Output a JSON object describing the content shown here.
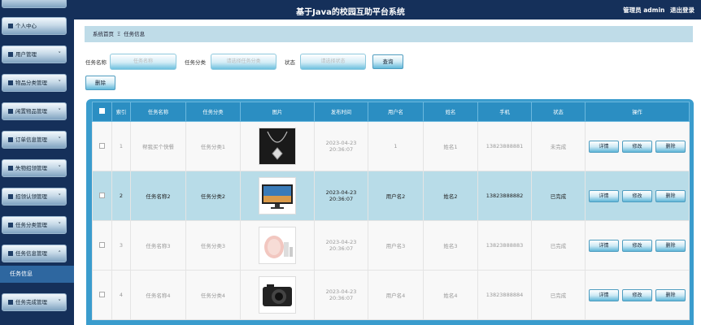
{
  "header": {
    "title": "基于Java的校园互助平台系统",
    "user_label": "管理员 admin",
    "logout": "退出登录"
  },
  "sidebar": {
    "items": [
      {
        "label": "个人中心"
      },
      {
        "label": "用户管理"
      },
      {
        "label": "物品分类管理"
      },
      {
        "label": "闲置物品管理"
      },
      {
        "label": "订单信息管理"
      },
      {
        "label": "失物招领管理"
      },
      {
        "label": "招领认领管理"
      },
      {
        "label": "任务分类管理"
      },
      {
        "label": "任务信息管理"
      },
      {
        "label": "任务完成管理"
      }
    ],
    "active_sub": "任务信息"
  },
  "breadcrumb": {
    "home": "系统首页",
    "sep": "Ξ",
    "current": "任务信息"
  },
  "search": {
    "name_label": "任务名称",
    "name_placeholder": "任务名称",
    "category_label": "任务分类",
    "category_placeholder": "请选择任务分类",
    "status_label": "状态",
    "status_placeholder": "请选择状态",
    "query_button": "查询"
  },
  "toolbar": {
    "delete_button": "删除"
  },
  "table": {
    "headers": [
      "索引",
      "任务名称",
      "任务分类",
      "图片",
      "发布时间",
      "用户名",
      "姓名",
      "手机",
      "状态",
      "操作"
    ],
    "rows": [
      {
        "index": "1",
        "name": "帮我买个快餐",
        "category": "任务分类1",
        "image": "necklace",
        "time": "2023-04-23 20:36:07",
        "username": "1",
        "realname": "姓名1",
        "phone": "13823888881",
        "status": "未完成"
      },
      {
        "index": "2",
        "name": "任务名称2",
        "category": "任务分类2",
        "image": "monitor",
        "time": "2023-04-23 20:36:07",
        "username": "用户名2",
        "realname": "姓名2",
        "phone": "13823888882",
        "status": "已完成"
      },
      {
        "index": "3",
        "name": "任务名称3",
        "category": "任务分类3",
        "image": "cosmetics",
        "time": "2023-04-23 20:36:07",
        "username": "用户名3",
        "realname": "姓名3",
        "phone": "13823888883",
        "status": "已完成"
      },
      {
        "index": "4",
        "name": "任务名称4",
        "category": "任务分类4",
        "image": "camera",
        "time": "2023-04-23 20:36:07",
        "username": "用户名4",
        "realname": "姓名4",
        "phone": "13823888884",
        "status": "已完成"
      }
    ],
    "actions": {
      "detail": "详情",
      "edit": "修改",
      "delete": "删除"
    }
  },
  "colors": {
    "header_bg": "#15305a",
    "table_header": "#2b8ec2",
    "highlight_row": "#b8dce8",
    "active_menu": "#2e67a0"
  }
}
